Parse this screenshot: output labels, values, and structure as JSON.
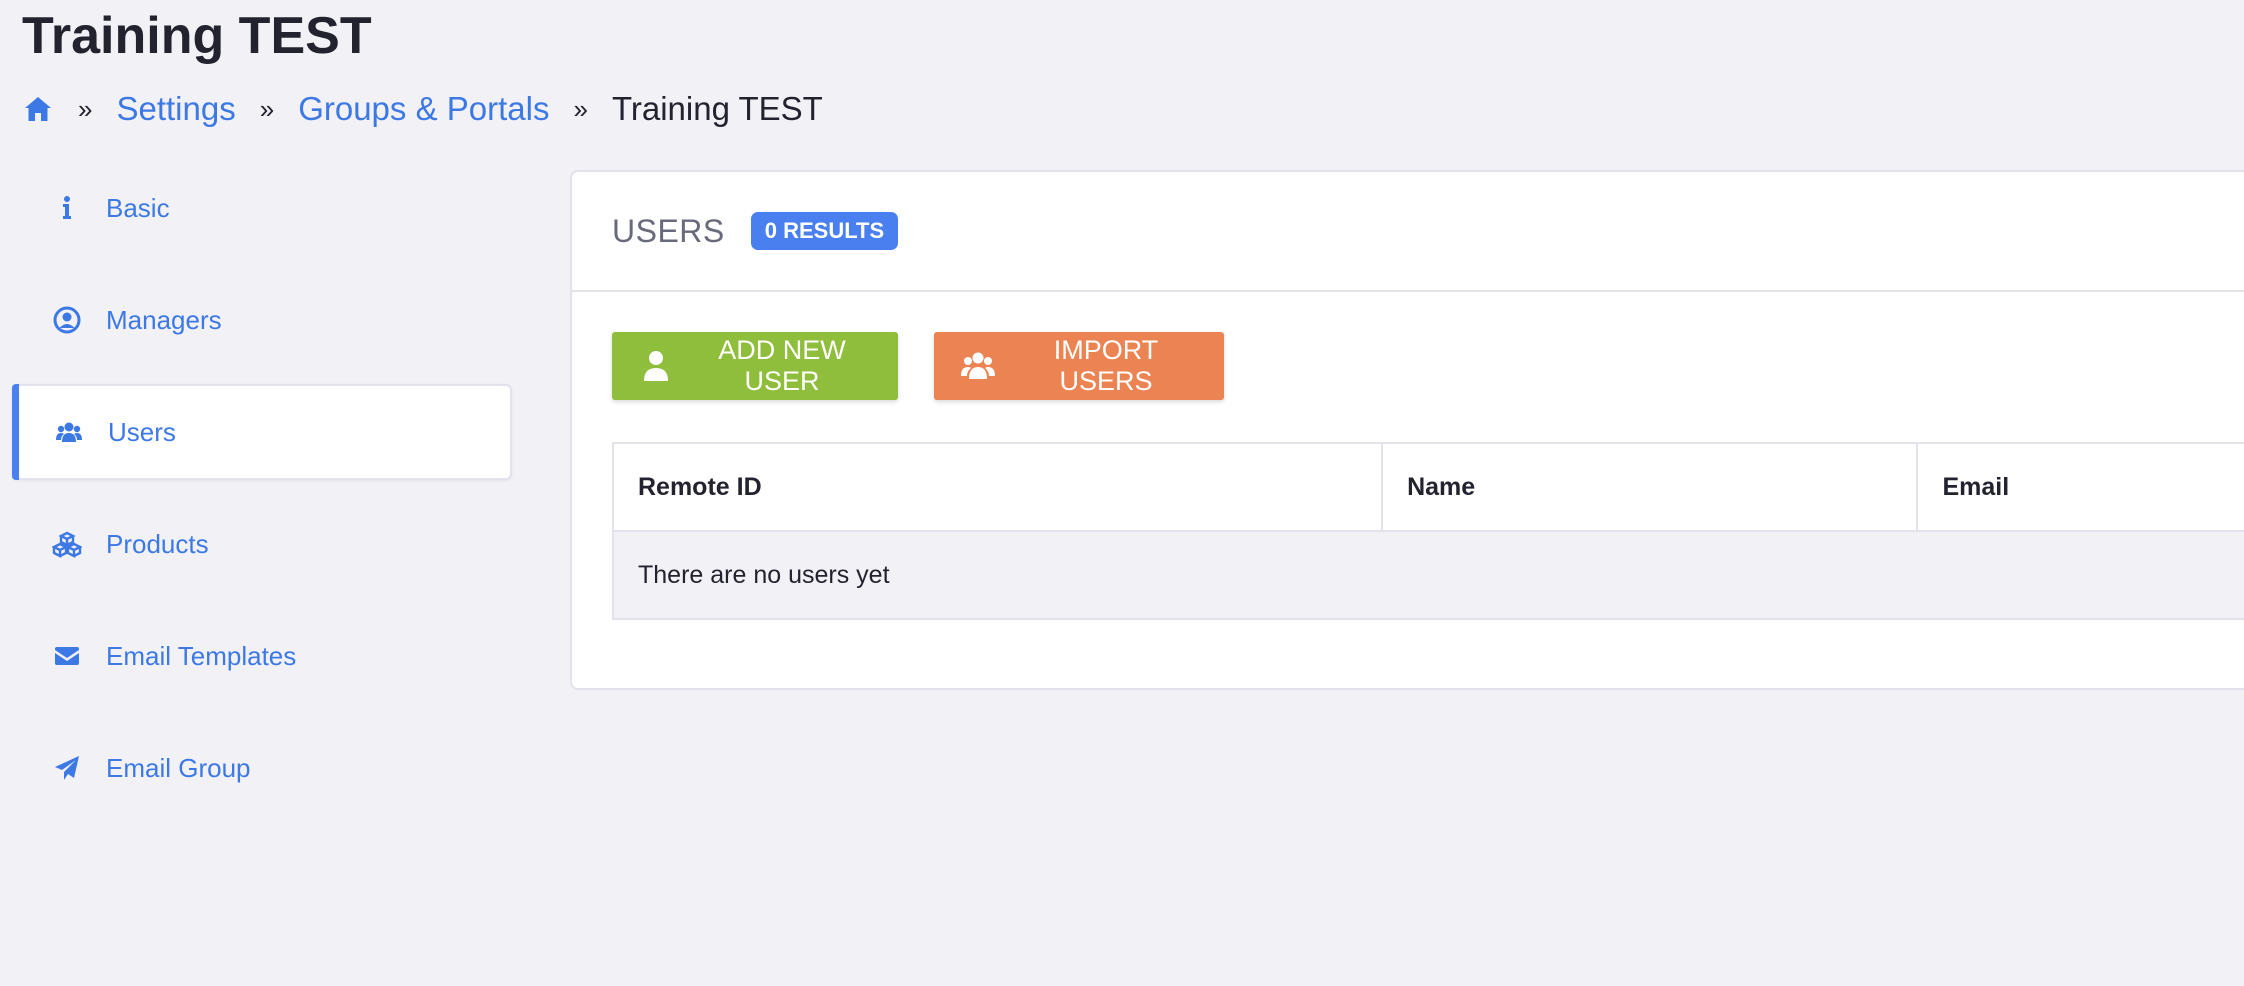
{
  "page": {
    "title": "Training TEST"
  },
  "breadcrumb": {
    "home_icon": "home-icon",
    "separator": "»",
    "items": [
      "Settings",
      "Groups & Portals"
    ],
    "current": "Training TEST"
  },
  "sidebar": {
    "items": [
      {
        "label": "Basic",
        "icon": "info-icon",
        "active": false
      },
      {
        "label": "Managers",
        "icon": "user-circle-icon",
        "active": false
      },
      {
        "label": "Users",
        "icon": "users-icon",
        "active": true
      },
      {
        "label": "Products",
        "icon": "cubes-icon",
        "active": false
      },
      {
        "label": "Email Templates",
        "icon": "envelope-icon",
        "active": false
      },
      {
        "label": "Email Group",
        "icon": "paper-plane-icon",
        "active": false
      }
    ]
  },
  "main": {
    "title": "USERS",
    "badge": "0 RESULTS",
    "add_button": "ADD NEW USER",
    "import_button": "IMPORT USERS",
    "table": {
      "columns": [
        "Remote ID",
        "Name",
        "Email"
      ],
      "empty_message": "There are no users yet"
    }
  },
  "colors": {
    "accent": "#4a7ff0",
    "link": "#3d79e5",
    "add_button": "#8fbd3c",
    "import_button": "#ec8352",
    "background": "#f2f1f6"
  }
}
